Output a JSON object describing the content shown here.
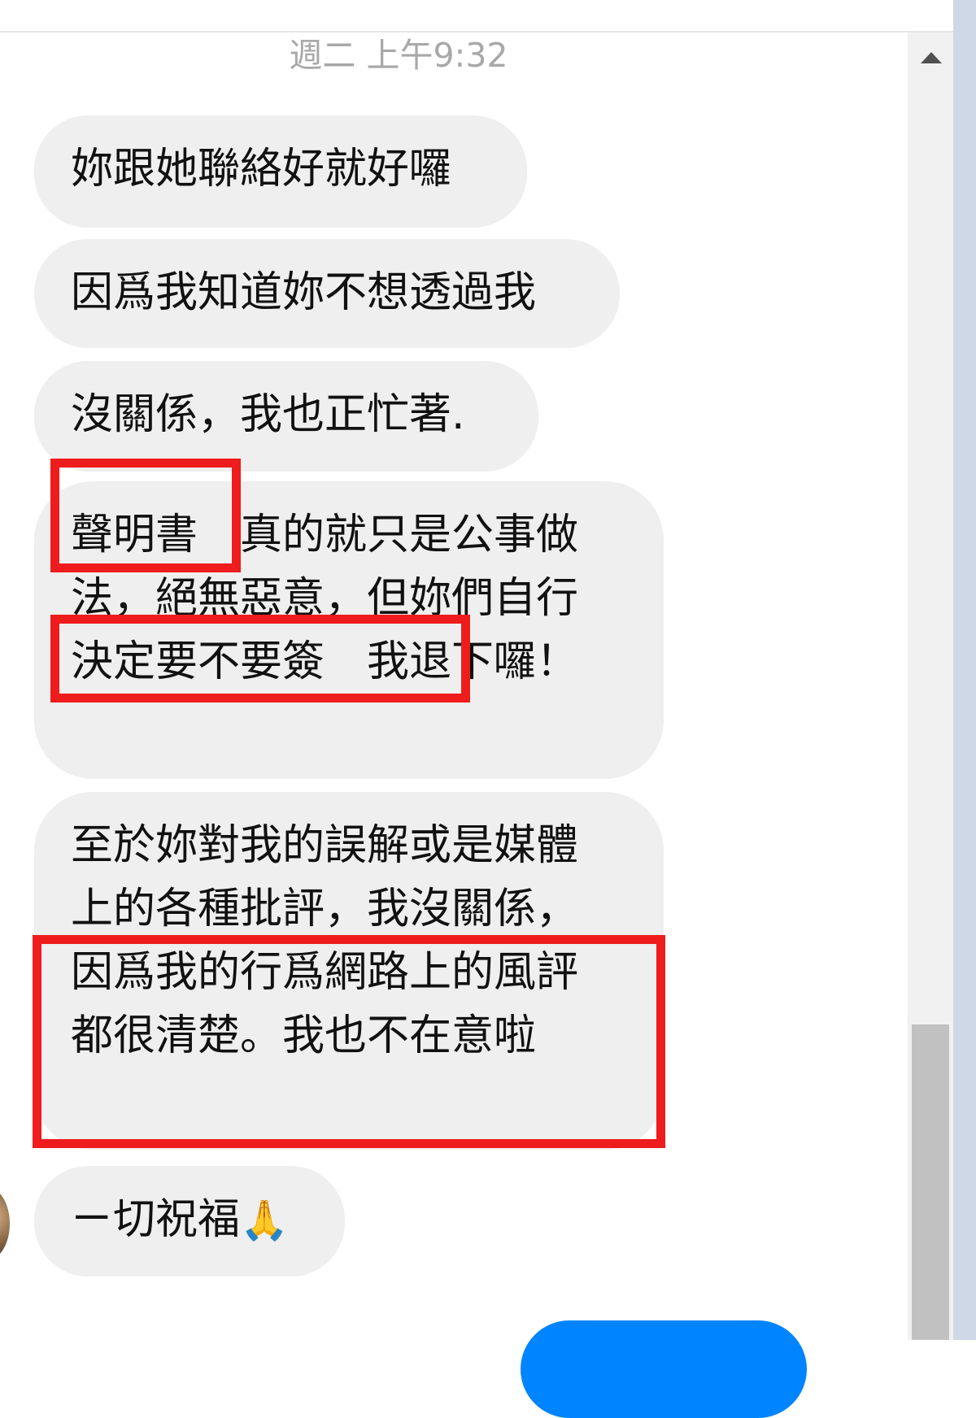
{
  "conversation": {
    "timestamp": "週二 上午9:32",
    "messages": [
      {
        "text": "妳跟她聯絡好就好囉"
      },
      {
        "text": "因爲我知道妳不想透過我"
      },
      {
        "text": "沒關係，我也正忙著."
      },
      {
        "text": "聲明書　真的就只是公事做法，絕無惡意，但妳們自行決定要不要簽　我退下囉！"
      },
      {
        "text": "至於妳對我的誤解或是媒體上的各種批評，我沒關係，因爲我的行爲網路上的風評都很清楚。我也不在意啦"
      },
      {
        "text": "ㄧ切祝福",
        "emoji": "🙏"
      }
    ]
  },
  "highlights": [
    "聲明書",
    "自行決定要不要簽",
    "係，因爲我的行爲網路上的風評都很清楚。我也不在意啦"
  ],
  "colors": {
    "bubble_incoming": "#efefef",
    "bubble_outgoing": "#0084ff",
    "highlight_red": "#ee1c1c",
    "timestamp_text": "#a8a8a8"
  }
}
